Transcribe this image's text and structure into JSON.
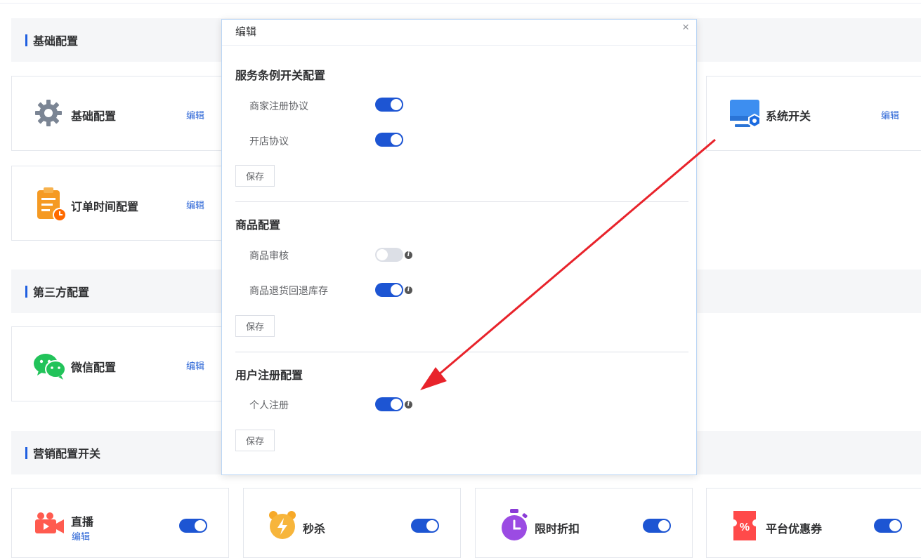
{
  "sections": {
    "basic": "基础配置",
    "third_party": "第三方配置",
    "marketing": "营销配置开关"
  },
  "cards": {
    "basic_config": {
      "label": "基础配置",
      "edit": "编辑",
      "icon": "gear-icon"
    },
    "order_time": {
      "label": "订单时间配置",
      "edit": "编辑",
      "icon": "clipboard-clock-icon"
    },
    "system_switch": {
      "label": "系统开关",
      "edit": "编辑",
      "icon": "monitor-settings-icon"
    },
    "wechat": {
      "label": "微信配置",
      "edit": "编辑",
      "icon": "wechat-icon"
    },
    "live": {
      "label": "直播",
      "edit": "编辑",
      "icon": "video-camera-icon",
      "enabled": true
    },
    "seckill": {
      "label": "秒杀",
      "icon": "alarm-clock-icon",
      "enabled": true
    },
    "time_discount": {
      "label": "限时折扣",
      "icon": "stopwatch-icon",
      "enabled": true
    },
    "platform_coupon": {
      "label": "平台优惠券",
      "icon": "coupon-percent-icon",
      "enabled": true
    }
  },
  "dialog": {
    "title": "编辑",
    "close": "×",
    "service_section": {
      "title": "服务条例开关配置",
      "rows": [
        {
          "label": "商家注册协议",
          "enabled": true
        },
        {
          "label": "开店协议",
          "enabled": true
        }
      ],
      "save": "保存"
    },
    "goods_section": {
      "title": "商品配置",
      "rows": [
        {
          "label": "商品审核",
          "enabled": false
        },
        {
          "label": "商品退货回退库存",
          "enabled": true
        }
      ],
      "save": "保存"
    },
    "user_section": {
      "title": "用户注册配置",
      "rows": [
        {
          "label": "个人注册",
          "enabled": true
        }
      ],
      "save": "保存"
    }
  },
  "colors": {
    "accent": "#1d55d3",
    "link": "#2a64d6",
    "arrow": "#e8232b",
    "section_bg": "#f5f6f8"
  }
}
